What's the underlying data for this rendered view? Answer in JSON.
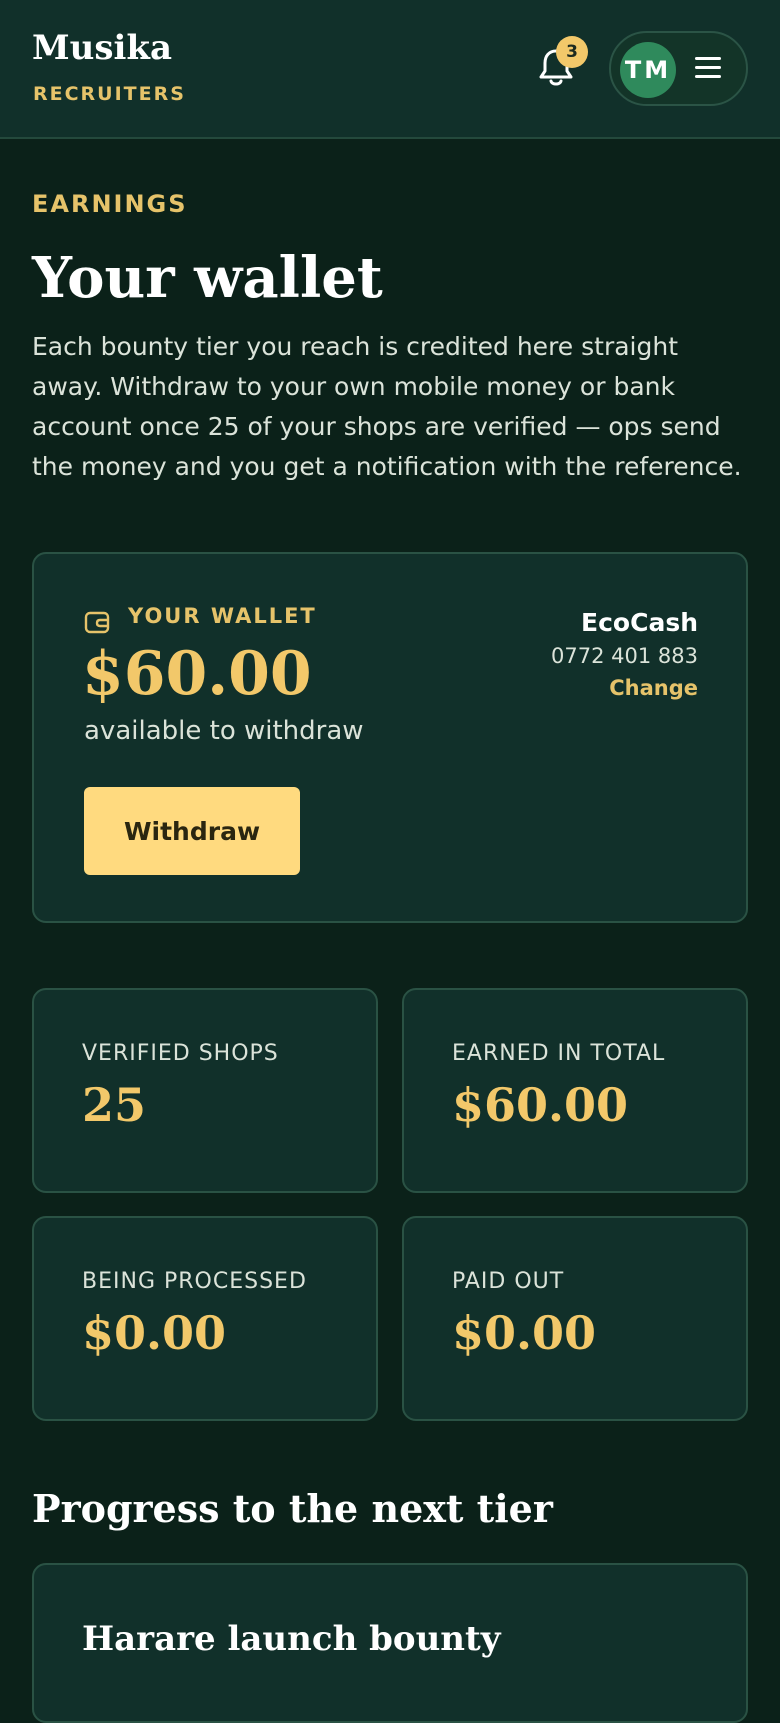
{
  "header": {
    "brand": "Musika",
    "brand_sub": "RECRUITERS",
    "notification_count": "3",
    "user_initials": "TM"
  },
  "page": {
    "eyebrow": "EARNINGS",
    "title": "Your wallet",
    "intro": "Each bounty tier you reach is credited here straight away. Withdraw to your own mobile money or bank account once 25 of your shops are verified — ops send the money and you get a notification with the reference."
  },
  "wallet": {
    "label": "YOUR WALLET",
    "amount": "$60.00",
    "caption": "available to withdraw",
    "withdraw_label": "Withdraw",
    "payout_method": "EcoCash",
    "payout_number": "0772 401 883",
    "change_label": "Change"
  },
  "stats": [
    {
      "label": "VERIFIED SHOPS",
      "value": "25"
    },
    {
      "label": "EARNED IN TOTAL",
      "value": "$60.00"
    },
    {
      "label": "BEING PROCESSED",
      "value": "$0.00"
    },
    {
      "label": "PAID OUT",
      "value": "$0.00"
    }
  ],
  "progress": {
    "section_title": "Progress to the next tier",
    "tier_title": "Harare launch bounty"
  },
  "colors": {
    "background": "#0b2119",
    "card": "#11302a",
    "accent_gold": "#f2c86a",
    "button": "#ffda7f",
    "avatar": "#2f8a5c"
  },
  "icons": [
    "bell-icon",
    "menu-icon",
    "wallet-icon"
  ]
}
